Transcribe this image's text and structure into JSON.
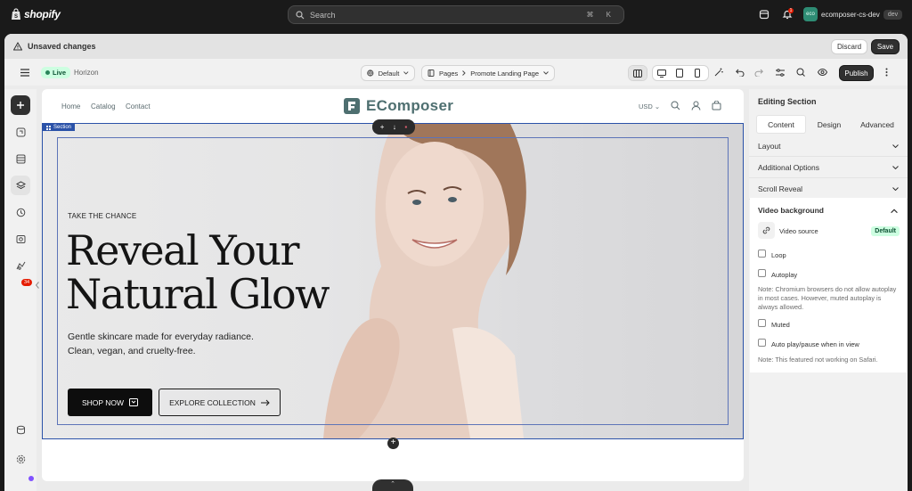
{
  "topbar": {
    "logo_text": "shopify",
    "search_placeholder": "Search",
    "search_shortcut": "⌘ K",
    "notification_count": "1",
    "store_initials": "eco",
    "store_name": "ecomposer-cs-dev",
    "store_env": "dev"
  },
  "unsaved_bar": {
    "message": "Unsaved changes",
    "discard_label": "Discard",
    "save_label": "Save"
  },
  "editor_bar": {
    "status": "Live",
    "theme_name": "Horizon",
    "template_select": "Default",
    "pages_label": "Pages",
    "page_select": "Promote Landing Page",
    "publish_label": "Publish"
  },
  "left_rail": {
    "badge_count": "34"
  },
  "storefront": {
    "nav": [
      "Home",
      "Catalog",
      "Contact"
    ],
    "brand": "EComposer",
    "currency": "USD",
    "section_tag": "Section",
    "kicker": "TAKE THE CHANCE",
    "headline_line1": "Reveal Your",
    "headline_line2": "Natural Glow",
    "sub_line1": "Gentle skincare made for everyday radiance.",
    "sub_line2": "Clean, vegan, and cruelty-free.",
    "cta_primary": "SHOP NOW",
    "cta_secondary": "EXPLORE COLLECTION"
  },
  "right_panel": {
    "title": "Editing Section",
    "tabs": [
      "Content",
      "Design",
      "Advanced"
    ],
    "active_tab": "Content",
    "accordions": [
      "Layout",
      "Additional Options",
      "Scroll Reveal"
    ],
    "video_background": {
      "heading": "Video background",
      "source_label": "Video source",
      "source_value": "Default",
      "loop_label": "Loop",
      "autoplay_label": "Autoplay",
      "autoplay_note": "Note: Chromium browsers do not allow autoplay in most cases. However, muted autoplay is always allowed.",
      "muted_label": "Muted",
      "auto_play_view_label": "Auto play/pause when in view",
      "safari_note": "Note: This featured not working on Safari."
    }
  },
  "colors": {
    "shopify_topbar": "#1a1a1a",
    "section_outline": "#2b52a8",
    "brand_teal": "#4e6f70",
    "live_green": "#29845a"
  }
}
